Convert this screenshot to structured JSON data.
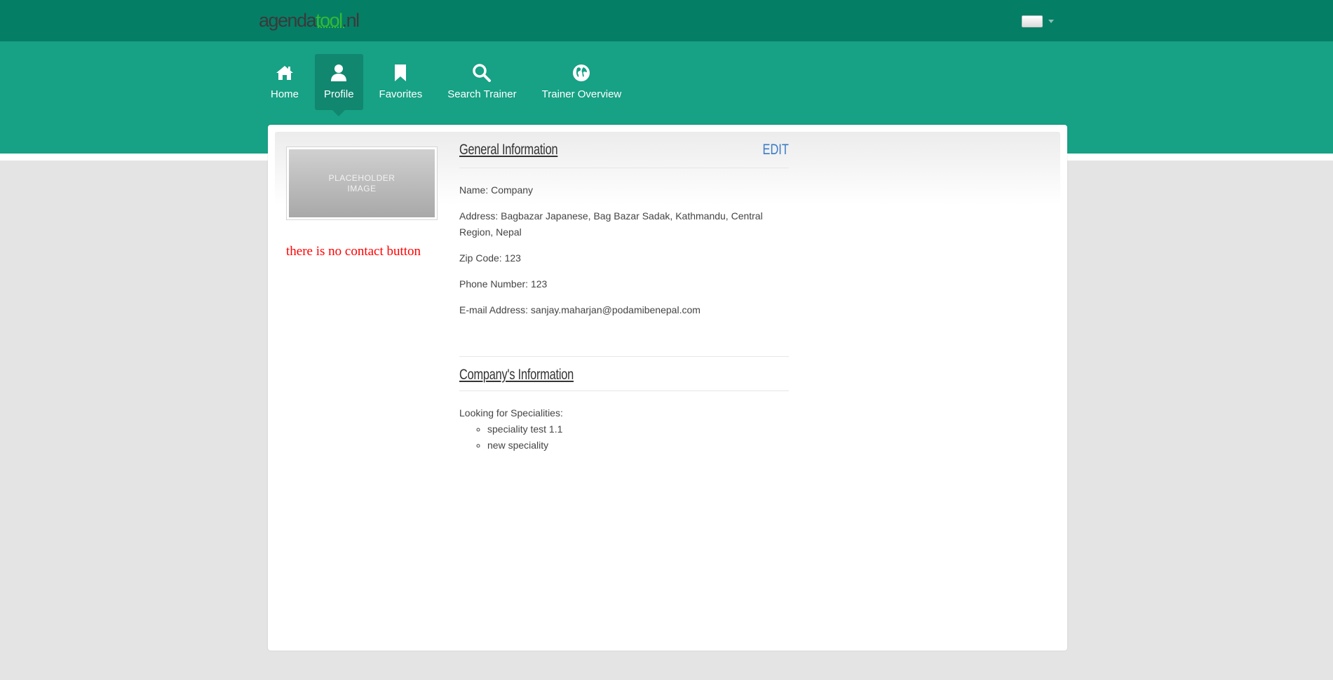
{
  "header": {
    "logo": {
      "part1": "agenda",
      "part2": "tool",
      "part3": ".nl"
    },
    "language_selector": {
      "flag_icon": "flag-icon"
    }
  },
  "nav": {
    "items": [
      {
        "label": "Home",
        "icon": "home-icon",
        "active": false
      },
      {
        "label": "Profile",
        "icon": "user-icon",
        "active": true
      },
      {
        "label": "Favorites",
        "icon": "bookmark-icon",
        "active": false
      },
      {
        "label": "Search Trainer",
        "icon": "search-icon",
        "active": false
      },
      {
        "label": "Trainer Overview",
        "icon": "globe-icon",
        "active": false
      }
    ]
  },
  "profile": {
    "placeholder_line1": "PLACEHOLDER",
    "placeholder_line2": "IMAGE",
    "note": "there is no contact button"
  },
  "general": {
    "title": "General Information",
    "edit_label": "EDIT",
    "name": "Name: Company",
    "address_line1": "Address: Bagbazar Japanese, Bag Bazar Sadak, Kathmandu, Central",
    "address_line2": "Region, Nepal",
    "zip": "Zip Code: 123",
    "phone": "Phone Number: 123",
    "email": "E-mail Address: sanjay.maharjan@podamibenepal.com"
  },
  "company": {
    "title": "Company's Information",
    "specialities_label": "Looking for Specialities:",
    "specialities": [
      "speciality test 1.1",
      "new speciality"
    ]
  },
  "colors": {
    "topbar": "#057e66",
    "navband": "#17a185",
    "nav_active": "#118770",
    "edit_link": "#3a7bc8",
    "note_red": "#ff0000"
  }
}
